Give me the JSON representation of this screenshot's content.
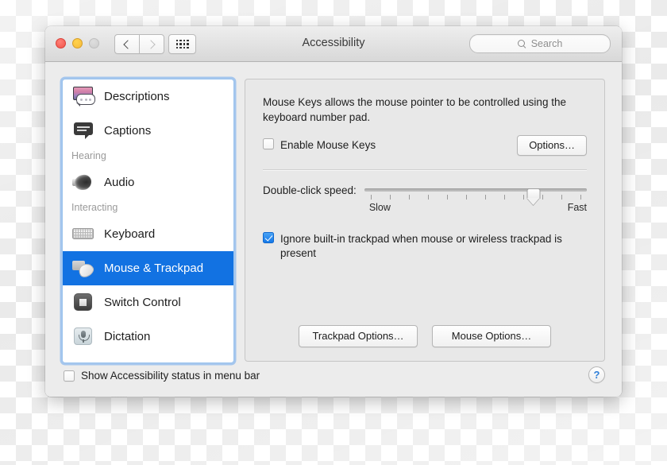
{
  "window": {
    "title": "Accessibility",
    "traffic_lights": [
      "close",
      "minimize",
      "zoom"
    ],
    "nav": {
      "back_icon": "chevron-left-icon",
      "forward_icon": "chevron-right-icon",
      "grid_icon": "show-all-grid-icon"
    },
    "search": {
      "placeholder": "Search",
      "icon": "search-icon",
      "value": ""
    }
  },
  "sidebar": {
    "items": [
      {
        "type": "item",
        "label": "Descriptions",
        "icon": "descriptions-icon",
        "selected": false
      },
      {
        "type": "item",
        "label": "Captions",
        "icon": "captions-icon",
        "selected": false
      },
      {
        "type": "header",
        "label": "Hearing"
      },
      {
        "type": "item",
        "label": "Audio",
        "icon": "audio-icon",
        "selected": false
      },
      {
        "type": "header",
        "label": "Interacting"
      },
      {
        "type": "item",
        "label": "Keyboard",
        "icon": "keyboard-icon",
        "selected": false
      },
      {
        "type": "item",
        "label": "Mouse & Trackpad",
        "icon": "mouse-trackpad-icon",
        "selected": true
      },
      {
        "type": "item",
        "label": "Switch Control",
        "icon": "switch-control-icon",
        "selected": false
      },
      {
        "type": "item",
        "label": "Dictation",
        "icon": "dictation-icon",
        "selected": false
      }
    ],
    "selected_color": "#1272e2",
    "focus_ring_color": "#6ca8ee"
  },
  "main": {
    "intro_text": "Mouse Keys allows the mouse pointer to be controlled using the keyboard number pad.",
    "enable_mouse_keys": {
      "label": "Enable Mouse Keys",
      "checked": false
    },
    "options_button": "Options…",
    "double_click": {
      "label": "Double-click speed:",
      "min_label": "Slow",
      "max_label": "Fast",
      "tick_count": 12,
      "value_percent": 76
    },
    "ignore_trackpad": {
      "label": "Ignore built-in trackpad when mouse or wireless trackpad is present",
      "checked": true
    },
    "trackpad_options_button": "Trackpad Options…",
    "mouse_options_button": "Mouse Options…"
  },
  "footer": {
    "show_status": {
      "label": "Show Accessibility status in menu bar",
      "checked": false
    },
    "help_button": "?"
  }
}
